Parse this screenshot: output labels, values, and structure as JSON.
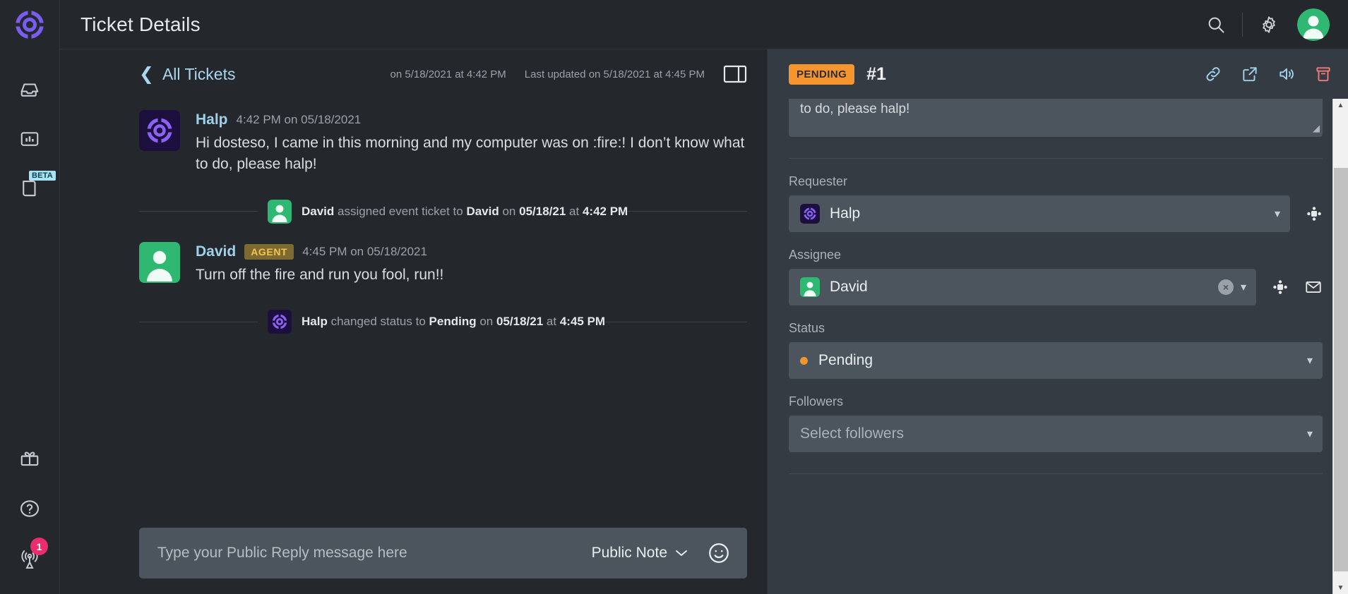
{
  "brand": {
    "logo_icon": "halp-lifebuoy-logo",
    "purple": "#7b5cf0",
    "orange": "#f6952e",
    "green": "#2eb872",
    "pink": "#eb2d6f"
  },
  "topbar": {
    "title": "Ticket Details",
    "search_icon": "search-icon",
    "settings_icon": "gear-icon",
    "avatar_icon": "user-avatar"
  },
  "sidebar": {
    "items": [
      {
        "name": "inbox",
        "icon": "inbox-icon",
        "badge": ""
      },
      {
        "name": "analytics",
        "icon": "bar-chart-icon",
        "badge": ""
      },
      {
        "name": "knowledge-base",
        "icon": "book-icon",
        "badge": "BETA"
      }
    ],
    "bottom_items": [
      {
        "name": "referrals",
        "icon": "gift-icon",
        "badge": ""
      },
      {
        "name": "help",
        "icon": "question-circle-icon",
        "badge": ""
      },
      {
        "name": "announcements",
        "icon": "broadcast-icon",
        "badge": "1"
      }
    ]
  },
  "conversation": {
    "back_label": "All Tickets",
    "created_stamp": "on 5/18/2021 at 4:42 PM",
    "updated_stamp": "Last updated on 5/18/2021 at 4:45 PM",
    "panel_toggle_icon": "split-panel-icon",
    "messages": [
      {
        "author": "Halp",
        "avatar": "halp-logo-avatar",
        "tag": "",
        "time": "4:42 PM on 05/18/2021",
        "text": "Hi dosteso, I came in this morning and my computer was on :fire:! I don’t know what to do, please halp!"
      },
      {
        "author": "David",
        "avatar": "person-avatar",
        "tag": "AGENT",
        "time": "4:45 PM on 05/18/2021",
        "text": "Turn off the fire and run you fool, run!!"
      }
    ],
    "events": [
      {
        "avatar": "person-avatar",
        "actor": "David",
        "action": "assigned event ticket to",
        "target": "David",
        "on_label": "on",
        "date": "05/18/21",
        "at_label": "at",
        "time": "4:42 PM"
      },
      {
        "avatar": "halp-logo-avatar",
        "actor": "Halp",
        "action": "changed status to",
        "target": "Pending",
        "on_label": "on",
        "date": "05/18/21",
        "at_label": "at",
        "time": "4:45 PM"
      }
    ],
    "composer": {
      "placeholder": "Type your Public Reply message here",
      "note_type": "Public Note",
      "emoji_icon": "smiley-icon"
    }
  },
  "details": {
    "status_badge": "PENDING",
    "ticket_number": "#1",
    "actions": [
      {
        "name": "copy-link",
        "icon": "link-icon",
        "color": "#9fd2ea"
      },
      {
        "name": "open-external",
        "icon": "external-link-icon",
        "color": "#9fd2ea"
      },
      {
        "name": "announce",
        "icon": "speaker-icon",
        "color": "#9fd2ea"
      },
      {
        "name": "delete",
        "icon": "trash-icon",
        "color": "#f07a7a"
      }
    ],
    "subject_text": "Hi dosteso, I came in this morning and my computer was on :fire:! I don’t know what to do, please halp!",
    "fields": [
      {
        "label": "Requester",
        "value": "Halp",
        "avatar": "halp-logo-avatar",
        "clearable": false,
        "side_icons": [
          "slack-icon"
        ]
      },
      {
        "label": "Assignee",
        "value": "David",
        "avatar": "person-avatar",
        "clearable": true,
        "side_icons": [
          "slack-icon",
          "email-icon"
        ]
      },
      {
        "label": "Status",
        "value": "Pending",
        "dot_color": "#f6952e",
        "clearable": false,
        "side_icons": []
      },
      {
        "label": "Followers",
        "placeholder": "Select followers",
        "clearable": false,
        "side_icons": []
      }
    ]
  }
}
